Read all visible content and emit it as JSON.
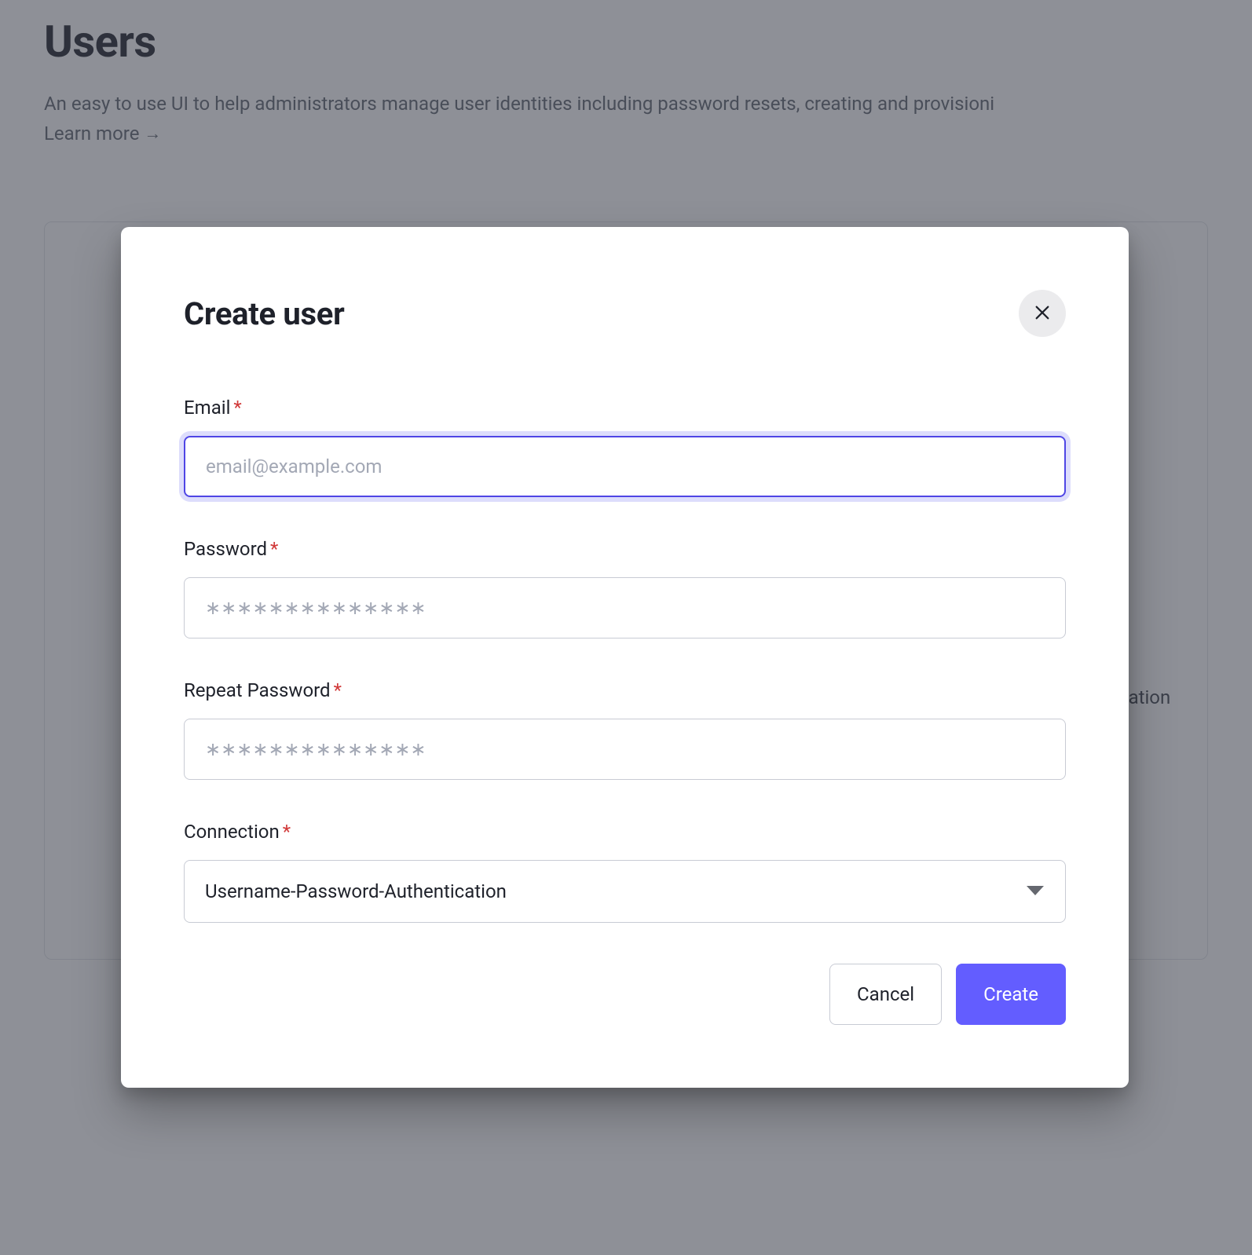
{
  "page": {
    "title": "Users",
    "subtitle": "An easy to use UI to help administrators manage user identities including password resets, creating and provisioni",
    "learn_more": "Learn more",
    "bg_word": "cation"
  },
  "modal": {
    "title": "Create user",
    "fields": {
      "email": {
        "label": "Email",
        "placeholder": "email@example.com",
        "value": ""
      },
      "password": {
        "label": "Password",
        "placeholder": "∗∗∗∗∗∗∗∗∗∗∗∗∗∗",
        "value": ""
      },
      "repeat_password": {
        "label": "Repeat Password",
        "placeholder": "∗∗∗∗∗∗∗∗∗∗∗∗∗∗",
        "value": ""
      },
      "connection": {
        "label": "Connection",
        "selected": "Username-Password-Authentication"
      }
    },
    "required_marker": "*",
    "buttons": {
      "cancel": "Cancel",
      "create": "Create"
    }
  }
}
